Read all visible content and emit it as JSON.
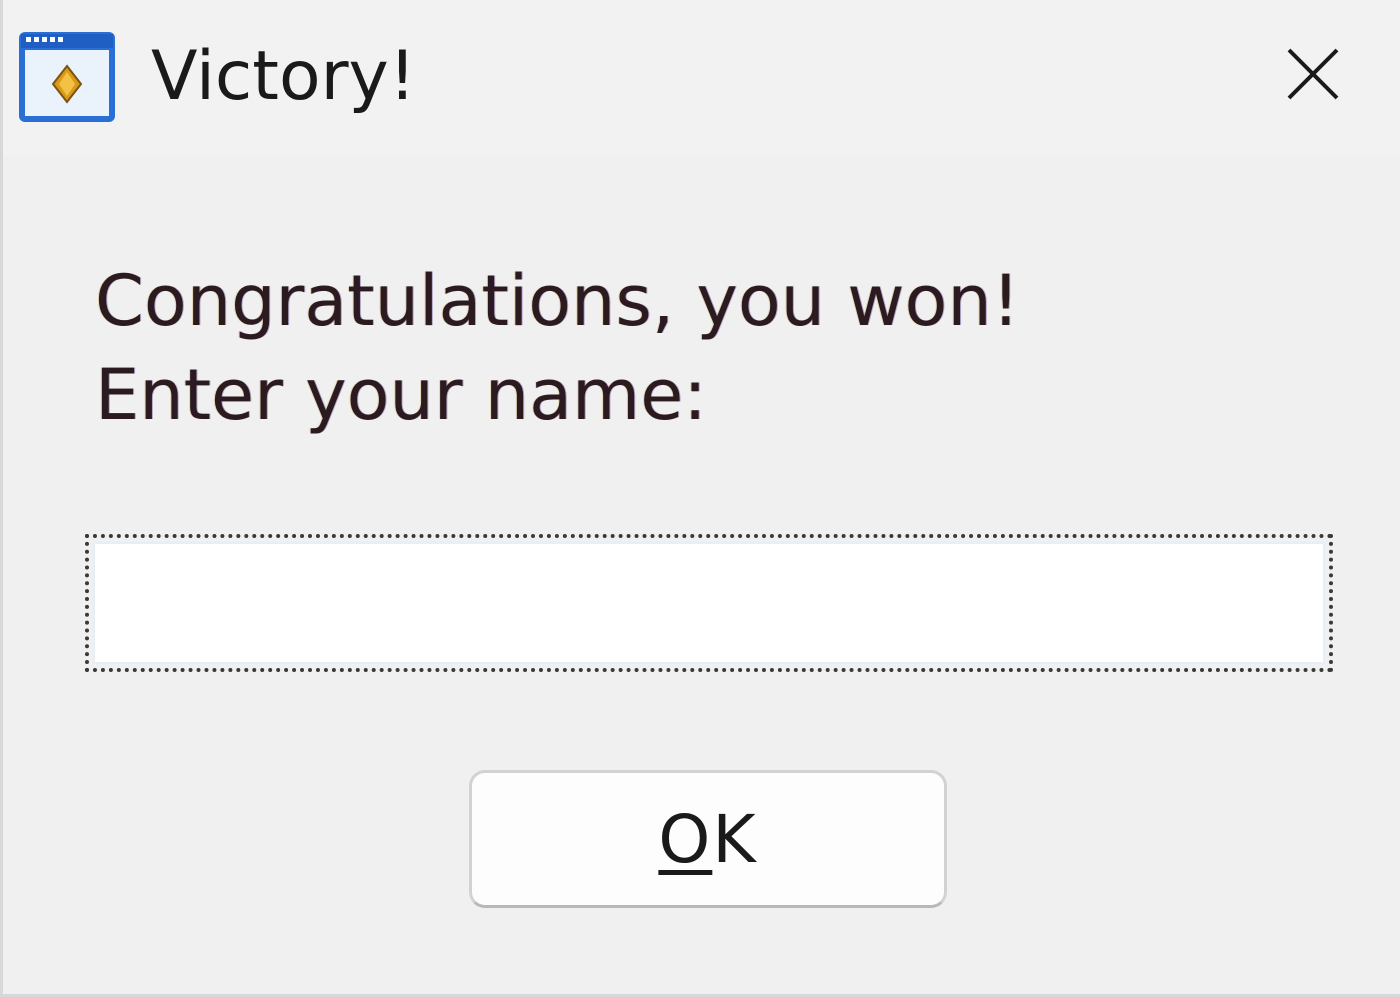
{
  "window": {
    "title": "Victory!",
    "app_icon": "application-window-icon",
    "close_icon": "close-icon"
  },
  "dialog": {
    "message_line1": "Congratulations, you won!",
    "message_line2": "Enter your name:",
    "name_input": {
      "value": "",
      "placeholder": ""
    },
    "ok_button": {
      "mnemonic": "O",
      "rest": "K"
    }
  },
  "colors": {
    "background": "#f0f0f0",
    "input_background": "#ffffff",
    "text": "#1a1a1a",
    "icon_blue": "#2a6fd6"
  }
}
